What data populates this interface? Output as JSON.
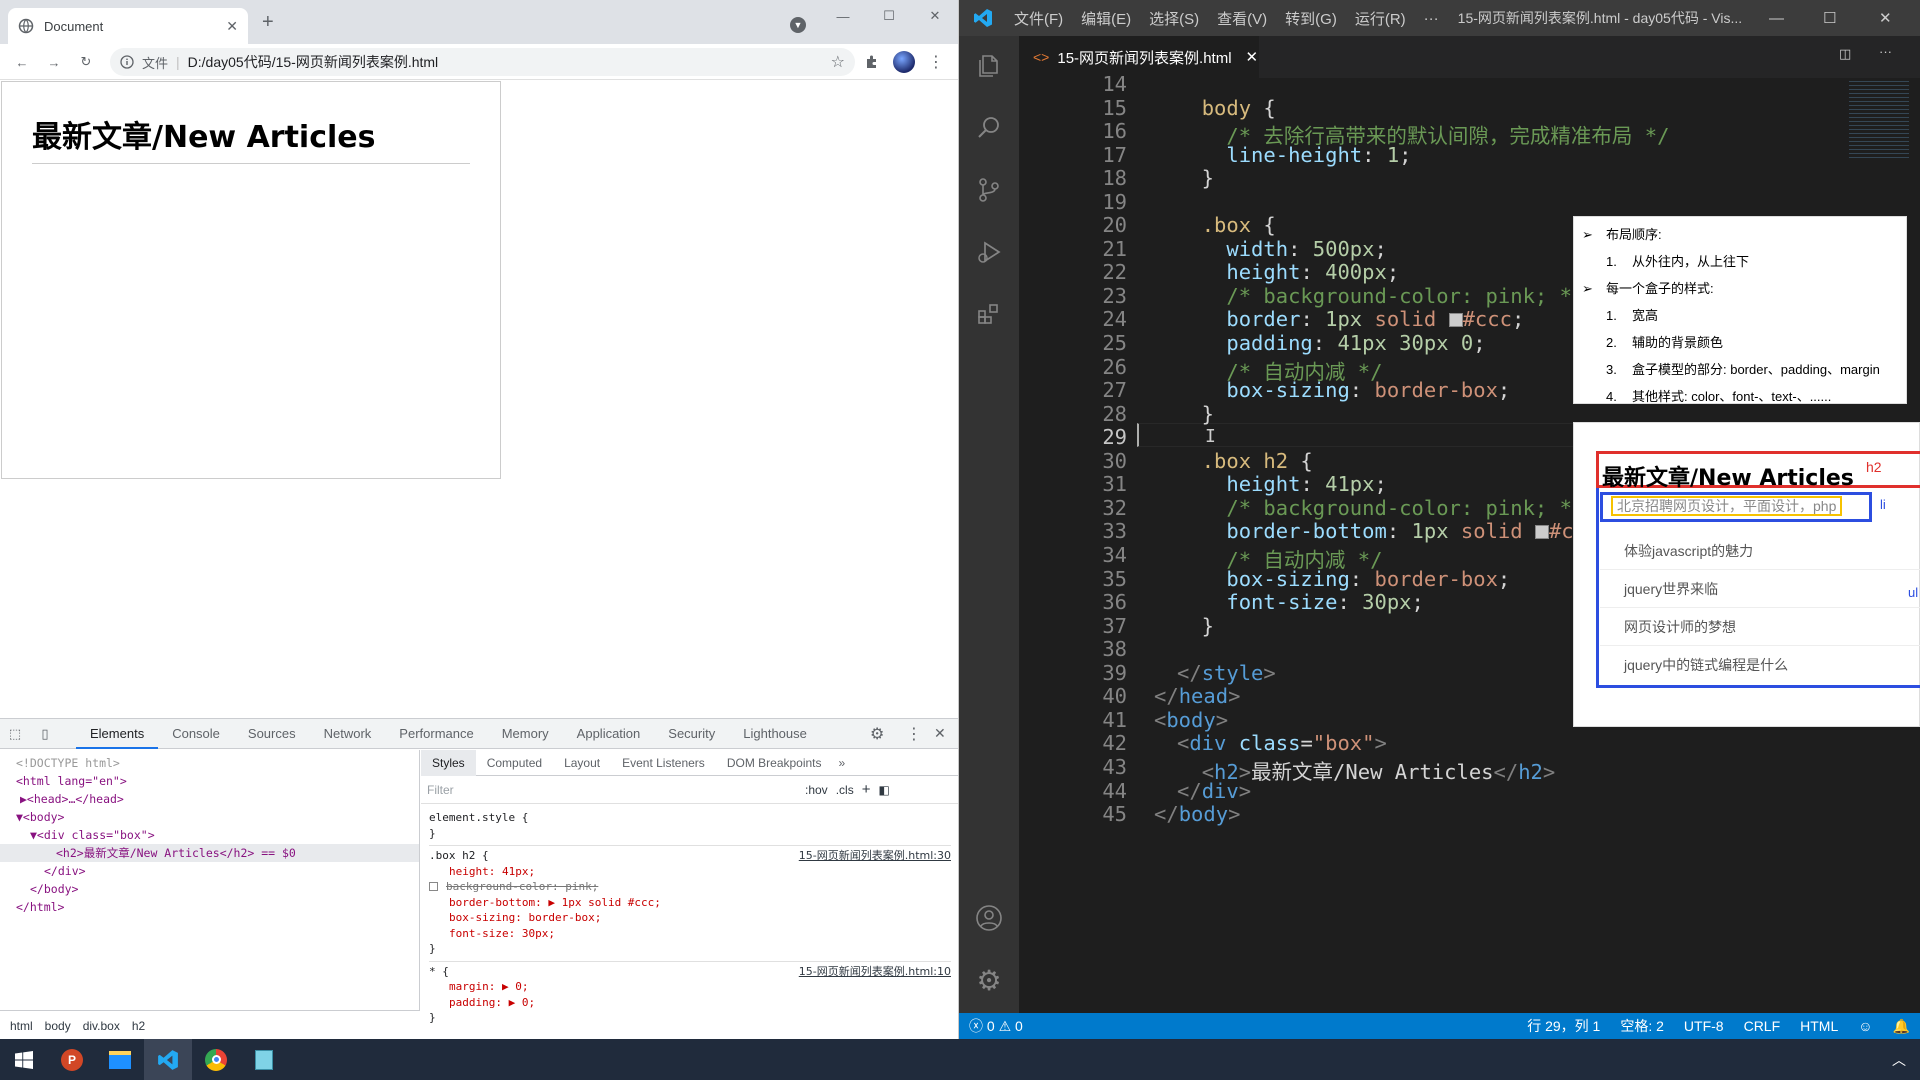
{
  "browser": {
    "tab_title": "Document",
    "address_scheme": "文件",
    "address_url": "D:/day05代码/15-网页新闻列表案例.html",
    "page_heading": "最新文章/New Articles"
  },
  "devtools": {
    "tabs": [
      "Elements",
      "Console",
      "Sources",
      "Network",
      "Performance",
      "Memory",
      "Application",
      "Security",
      "Lighthouse"
    ],
    "active_tab": "Elements",
    "dom_lines": [
      {
        "text": "<!DOCTYPE html>",
        "indent": 0
      },
      {
        "text": "<html lang=\"en\">",
        "indent": 0
      },
      {
        "text": "▶<head>…</head>",
        "indent": 1
      },
      {
        "text": "▼<body>",
        "indent": 0
      },
      {
        "text": "▼<div class=\"box\">",
        "indent": 1
      },
      {
        "text": "<h2>最新文章/New Articles</h2> == $0",
        "indent": 3
      },
      {
        "text": "</div>",
        "indent": 2
      },
      {
        "text": "</body>",
        "indent": 1
      },
      {
        "text": "</html>",
        "indent": 0
      }
    ],
    "breadcrumbs": [
      "html",
      "body",
      "div.box",
      "h2"
    ],
    "style_tabs": [
      "Styles",
      "Computed",
      "Layout",
      "Event Listeners",
      "DOM Breakpoints"
    ],
    "filter_placeholder": "Filter",
    "hov": ":hov",
    "cls": ".cls",
    "rule1_selector": "element.style {",
    "rule2_selector": ".box h2 {",
    "rule2_src": "15-网页新闻列表案例.html:30",
    "rule2_props": [
      "height: 41px;",
      "background-color: pink;",
      "border-bottom: ▶ 1px solid #ccc;",
      "box-sizing: border-box;",
      "font-size: 30px;"
    ],
    "rule3_selector": "* {",
    "rule3_src": "15-网页新闻列表案例.html:10",
    "rule3_props": [
      "margin: ▶ 0;",
      "padding: ▶ 0;"
    ],
    "close_brace": "}"
  },
  "vscode": {
    "menus": [
      "文件(F)",
      "编辑(E)",
      "选择(S)",
      "查看(V)",
      "转到(G)",
      "运行(R)",
      "···"
    ],
    "window_title": "15-网页新闻列表案例.html - day05代码 - Vis...",
    "tab_label": "15-网页新闻列表案例.html",
    "line_numbers": [
      "14",
      "15",
      "16",
      "17",
      "18",
      "19",
      "20",
      "21",
      "22",
      "23",
      "24",
      "25",
      "26",
      "27",
      "28",
      "29",
      "30",
      "31",
      "32",
      "33",
      "34",
      "35",
      "36",
      "37",
      "38",
      "39",
      "40",
      "41",
      "42",
      "43",
      "44",
      "45"
    ],
    "status": {
      "errors": "0",
      "warnings": "0",
      "position": "行 29，列 1",
      "spaces": "空格: 2",
      "encoding": "UTF-8",
      "eol": "CRLF",
      "language": "HTML"
    }
  },
  "notes": {
    "items": [
      {
        "bullet": "➢",
        "text": "布局顺序:"
      },
      {
        "bullet": "1.",
        "text": "从外往内，从上往下"
      },
      {
        "bullet": "➢",
        "text": "每一个盒子的样式:"
      },
      {
        "bullet": "1.",
        "text": "宽高"
      },
      {
        "bullet": "2.",
        "text": "辅助的背景颜色"
      },
      {
        "bullet": "3.",
        "text": "盒子模型的部分: border、padding、margin"
      },
      {
        "bullet": "4.",
        "text": "其他样式: color、font-、text-、......"
      }
    ]
  },
  "preview": {
    "heading": "最新文章/New Articles",
    "heading_tag": "h2",
    "li_tag": "li",
    "ul_tag": "ul",
    "items": [
      "北京招聘网页设计，平面设计，php",
      "体验javascript的魅力",
      "jquery世界来临",
      "网页设计师的梦想",
      "jquery中的链式编程是什么"
    ]
  },
  "colors": {
    "vscode_blue": "#007acc",
    "chrome_tab_strip": "#dee1e6",
    "preview_h2_border": "#e0302c",
    "preview_ul_border": "#2c4ee0",
    "preview_li_highlight": "#f6c200"
  }
}
